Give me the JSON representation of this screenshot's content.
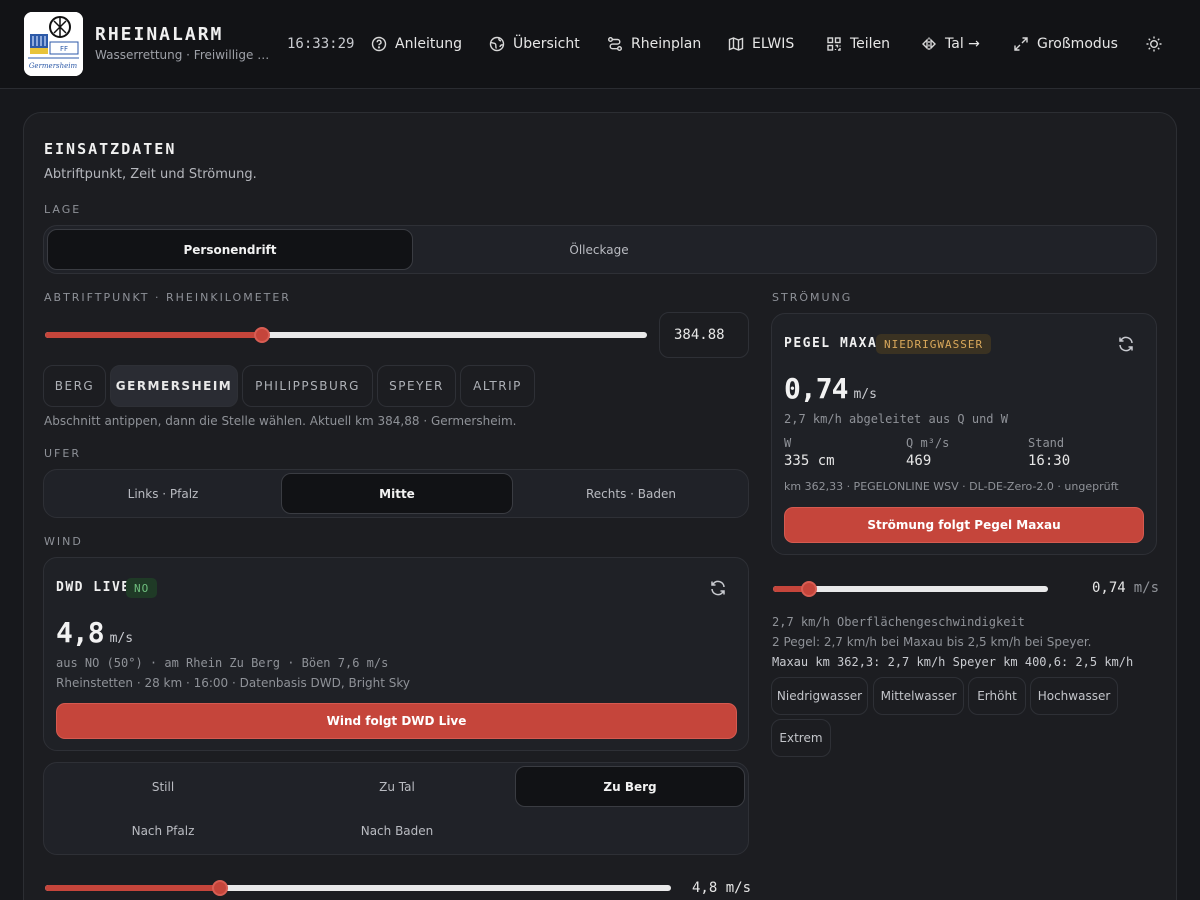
{
  "header": {
    "title": "RHEINALARM",
    "subtitle": "Wasserrettung · Freiwillige Feuerwehr Germersheim",
    "time": "16:33:29",
    "nav": [
      {
        "label": "Anleitung",
        "icon": "help-circle-icon"
      },
      {
        "label": "Übersicht",
        "icon": "globe-icon"
      },
      {
        "label": "Rheinplan",
        "icon": "route-icon"
      },
      {
        "label": "ELWIS",
        "icon": "map-icon"
      },
      {
        "label": "Teilen",
        "icon": "qr-code-icon"
      },
      {
        "label": "Tal →",
        "icon": "flip-icon"
      },
      {
        "label": "Großmodus",
        "icon": "expand-icon"
      }
    ],
    "theme_icon": "sun-icon",
    "logo_text": "FF",
    "logo_script": "Germersheim"
  },
  "einsatz": {
    "title": "EINSATZDATEN",
    "subtitle": "Abtriftpunkt, Zeit und Strömung.",
    "lage_label": "LAGE",
    "lage_options": [
      "Personendrift",
      "Ölleckage"
    ],
    "lage_selected": 0,
    "abtrift_label": "ABTRIFTPUNKT · RHEINKILOMETER",
    "km_value": "384.88",
    "km_slider_fraction": 0.36,
    "sections": [
      "BERG",
      "GERMERSHEIM",
      "PHILIPPSBURG",
      "SPEYER",
      "ALTRIP"
    ],
    "section_selected": 1,
    "section_hint": "Abschnitt antippen, dann die Stelle wählen. Aktuell km 384,88 · Germersheim.",
    "ufer_label": "UFER",
    "ufer_options": [
      "Links · Pfalz",
      "Mitte",
      "Rechts · Baden"
    ],
    "ufer_selected": 1,
    "wind_label": "WIND"
  },
  "wind": {
    "title": "DWD LIVE",
    "badge": "NO",
    "value": "4,8",
    "unit": "m/s",
    "detail": "aus NO (50°) · am Rhein Zu Berg · Böen 7,6 m/s",
    "source": "Rheinstetten · 28 km · 16:00 · Datenbasis DWD, Bright Sky",
    "button": "Wind folgt DWD Live",
    "directions": [
      "Still",
      "Zu Tal",
      "Zu Berg",
      "Nach Pfalz",
      "Nach Baden"
    ],
    "direction_selected": 2,
    "slider_fraction": 0.28,
    "slider_value": "4,8 m/s"
  },
  "stroemung": {
    "label": "STRÖMUNG",
    "gauge_title": "PEGEL MAXAU",
    "gauge_badge": "NIEDRIGWASSER",
    "value": "0,74",
    "unit": "m/s",
    "derived": "2,7 km/h abgeleitet aus Q und W",
    "stats": [
      {
        "label": "W",
        "value": "335 cm"
      },
      {
        "label": "Q m³/s",
        "value": "469"
      },
      {
        "label": "Stand",
        "value": "16:30"
      }
    ],
    "source": "km 362,33 · PEGELONLINE WSV · DL-DE-Zero-2.0 · ungeprüft",
    "button": "Strömung folgt Pegel Maxau",
    "slider_fraction": 0.13,
    "slider_value": "0,74",
    "slider_unit": "m/s",
    "surface": "2,7 km/h Oberflächengeschwindigkeit",
    "gauges_note": "2 Pegel: 2,7 km/h bei Maxau bis 2,5 km/h bei Speyer.",
    "gauges_detail": "Maxau km 362,3: 2,7 km/h  Speyer km 400,6: 2,5 km/h",
    "levels": [
      "Niedrigwasser",
      "Mittelwasser",
      "Erhöht",
      "Hochwasser",
      "Extrem"
    ]
  },
  "colors": {
    "accent": "#c5453b",
    "badge_green_bg": "#1f3a26",
    "badge_green_fg": "#6fbf7e",
    "badge_amber_bg": "#3a3222",
    "badge_amber_fg": "#d9a85b"
  }
}
